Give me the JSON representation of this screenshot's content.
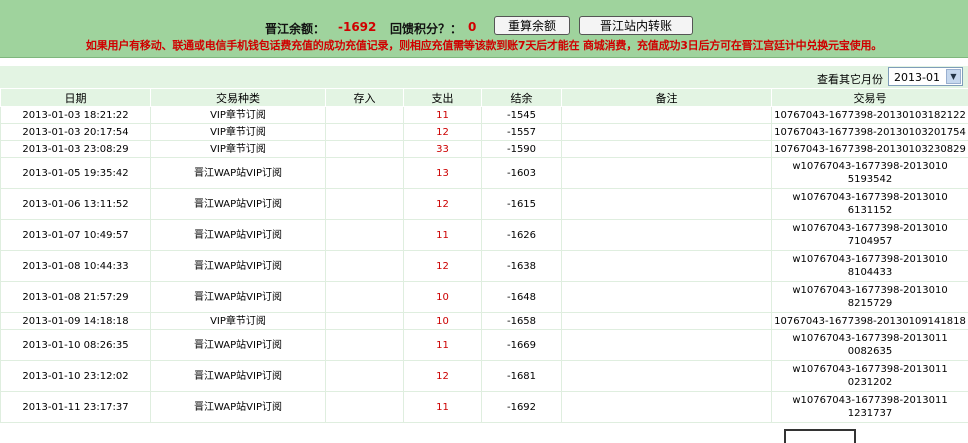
{
  "summary": {
    "balance_label": "晋江余额：",
    "balance_value": "-1692",
    "points_label": "回馈积分？：",
    "points_value": "0",
    "recalc_button": "重算余额",
    "transfer_button": "晋江站内转账"
  },
  "notice": "如果用户有移动、联通或电信手机钱包话费充值的成功充值记录，则相应充值需等该款到账7天后才能在 商城消费，充值成功3日后方可在晋江宫廷计中兑换元宝使用。",
  "filter": {
    "label": "查看其它月份",
    "selected_month": "2013-01"
  },
  "table": {
    "headers": [
      "日期",
      "交易种类",
      "存入",
      "支出",
      "结余",
      "备注",
      "交易号"
    ],
    "rows": [
      {
        "date": "2013-01-03 18:21:22",
        "type": "VIP章节订阅",
        "deposit": "",
        "expense": "11",
        "balance": "-1545",
        "note": "",
        "txn": "10767043-1677398-20130103182122"
      },
      {
        "date": "2013-01-03 20:17:54",
        "type": "VIP章节订阅",
        "deposit": "",
        "expense": "12",
        "balance": "-1557",
        "note": "",
        "txn": "10767043-1677398-20130103201754"
      },
      {
        "date": "2013-01-03 23:08:29",
        "type": "VIP章节订阅",
        "deposit": "",
        "expense": "33",
        "balance": "-1590",
        "note": "",
        "txn": "10767043-1677398-20130103230829"
      },
      {
        "date": "2013-01-05 19:35:42",
        "type": "晋江WAP站VIP订阅",
        "deposit": "",
        "expense": "13",
        "balance": "-1603",
        "note": "",
        "txn": "w10767043-1677398-20130105193542"
      },
      {
        "date": "2013-01-06 13:11:52",
        "type": "晋江WAP站VIP订阅",
        "deposit": "",
        "expense": "12",
        "balance": "-1615",
        "note": "",
        "txn": "w10767043-1677398-20130106131152"
      },
      {
        "date": "2013-01-07 10:49:57",
        "type": "晋江WAP站VIP订阅",
        "deposit": "",
        "expense": "11",
        "balance": "-1626",
        "note": "",
        "txn": "w10767043-1677398-20130107104957"
      },
      {
        "date": "2013-01-08 10:44:33",
        "type": "晋江WAP站VIP订阅",
        "deposit": "",
        "expense": "12",
        "balance": "-1638",
        "note": "",
        "txn": "w10767043-1677398-20130108104433"
      },
      {
        "date": "2013-01-08 21:57:29",
        "type": "晋江WAP站VIP订阅",
        "deposit": "",
        "expense": "10",
        "balance": "-1648",
        "note": "",
        "txn": "w10767043-1677398-20130108215729"
      },
      {
        "date": "2013-01-09 14:18:18",
        "type": "VIP章节订阅",
        "deposit": "",
        "expense": "10",
        "balance": "-1658",
        "note": "",
        "txn": "10767043-1677398-20130109141818"
      },
      {
        "date": "2013-01-10 08:26:35",
        "type": "晋江WAP站VIP订阅",
        "deposit": "",
        "expense": "11",
        "balance": "-1669",
        "note": "",
        "txn": "w10767043-1677398-20130110082635"
      },
      {
        "date": "2013-01-10 23:12:02",
        "type": "晋江WAP站VIP订阅",
        "deposit": "",
        "expense": "12",
        "balance": "-1681",
        "note": "",
        "txn": "w10767043-1677398-20130110231202"
      },
      {
        "date": "2013-01-11 23:17:37",
        "type": "晋江WAP站VIP订阅",
        "deposit": "",
        "expense": "11",
        "balance": "-1692",
        "note": "",
        "txn": "w10767043-1677398-20130111231737"
      }
    ]
  },
  "colors": {
    "header_bg": "#9fd39d",
    "row_header_bg": "#e3f4e3",
    "accent_red": "#cc0000"
  }
}
